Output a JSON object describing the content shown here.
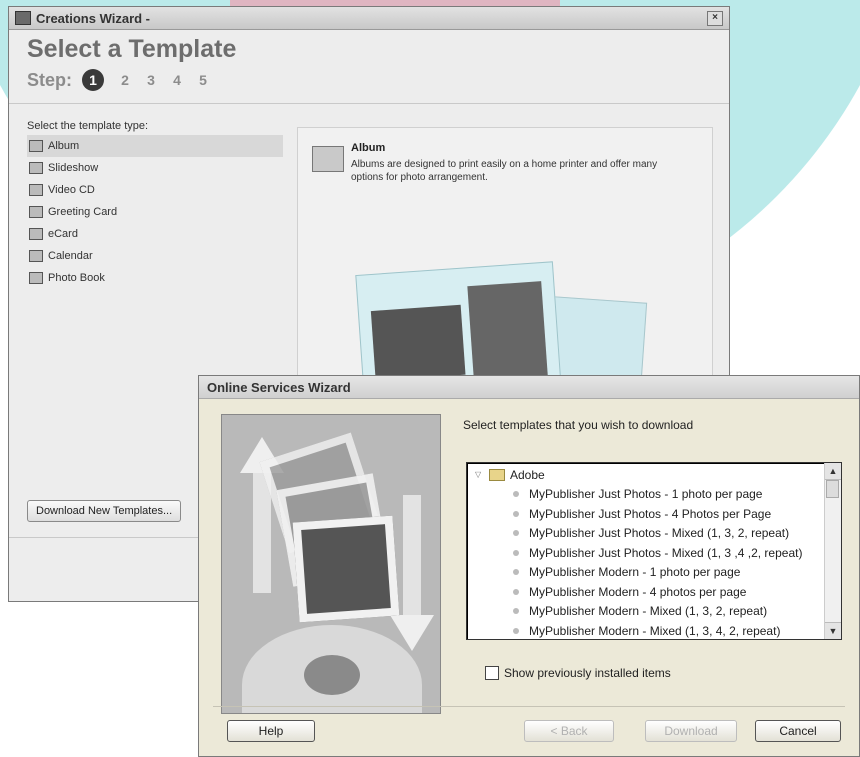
{
  "creations_wizard": {
    "title": "Creations Wizard -",
    "heading": "Select a Template",
    "steps_label": "Step:",
    "steps": [
      "1",
      "2",
      "3",
      "4",
      "5"
    ],
    "template_type_label": "Select the template type:",
    "template_types": [
      "Album",
      "Slideshow",
      "Video CD",
      "Greeting Card",
      "eCard",
      "Calendar",
      "Photo Book"
    ],
    "selected_index": 0,
    "description_title": "Album",
    "description_text": "Albums are designed to print easily on a home printer and offer many options for photo arrangement.",
    "download_button": "Download New Templates..."
  },
  "online_services_wizard": {
    "title": "Online Services Wizard",
    "prompt": "Select templates that you wish to download",
    "tree": {
      "root": "Adobe",
      "items": [
        "MyPublisher Just Photos - 1 photo per page",
        "MyPublisher Just Photos - 4 Photos per Page",
        "MyPublisher Just Photos - Mixed (1, 3, 2, repeat)",
        "MyPublisher Just Photos - Mixed (1, 3 ,4 ,2, repeat)",
        "MyPublisher Modern - 1 photo per page",
        "MyPublisher Modern - 4 photos per page",
        "MyPublisher Modern - Mixed (1, 3, 2, repeat)",
        "MyPublisher Modern - Mixed (1, 3, 4, 2, repeat)"
      ]
    },
    "show_previous_label": "Show previously installed items",
    "show_previous_checked": false,
    "buttons": {
      "help": "Help",
      "back": "< Back",
      "download": "Download",
      "cancel": "Cancel"
    }
  }
}
